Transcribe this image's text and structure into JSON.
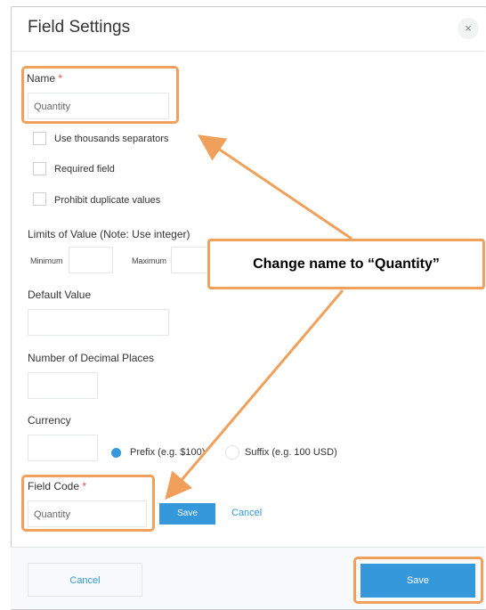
{
  "dialog": {
    "title": "Field Settings",
    "close_glyph": "×"
  },
  "form": {
    "name_label": "Name",
    "required_mark": "*",
    "name_value": "Quantity",
    "checkboxes": [
      {
        "label": "Use thousands separators",
        "checked": false
      },
      {
        "label": "Required field",
        "checked": false
      },
      {
        "label": "Prohibit duplicate values",
        "checked": false
      }
    ],
    "limits_label": "Limits of Value (Note: Use integer)",
    "minimum_label": "Minimum",
    "maximum_label": "Maximum",
    "default_value_label": "Default Value",
    "decimal_places_label": "Number of Decimal Places",
    "currency_label": "Currency",
    "prefix_label": "Prefix (e.g. $100)",
    "suffix_label": "Suffix (e.g. 100 USD)",
    "field_code_label": "Field Code",
    "field_code_value": "Quantity",
    "field_code_save": "Save",
    "field_code_cancel": "Cancel"
  },
  "footer": {
    "cancel_label": "Cancel",
    "save_label": "Save"
  },
  "annotation": {
    "callout_text": "Change name to “Quantity”",
    "color": "#f0a05a"
  },
  "colors": {
    "accent": "#3498db",
    "required": "#e74c3c",
    "highlight": "#f0a05a"
  }
}
